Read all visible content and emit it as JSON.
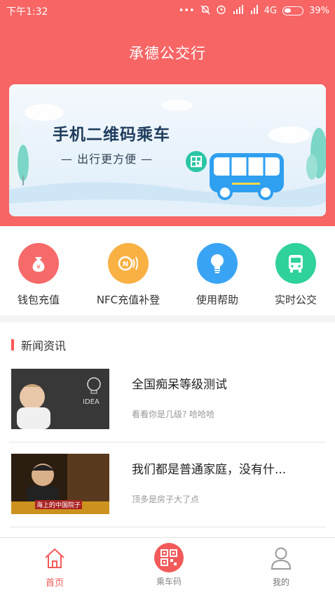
{
  "status": {
    "time": "下午1:32",
    "network": "4G",
    "battery": "39%"
  },
  "header": {
    "title": "承德公交行"
  },
  "banner": {
    "title": "手机二维码乘车",
    "subtitle": "— 出行更方便 —"
  },
  "actions": [
    {
      "label": "钱包充值",
      "icon": "money-bag-icon",
      "color": "#f76a6a"
    },
    {
      "label": "NFC充值补登",
      "icon": "nfc-icon",
      "color": "#f9b144"
    },
    {
      "label": "使用帮助",
      "icon": "lightbulb-icon",
      "color": "#3aa4f4"
    },
    {
      "label": "实时公交",
      "icon": "bus-icon",
      "color": "#2fd29a"
    }
  ],
  "news": {
    "heading": "新闻资讯",
    "items": [
      {
        "title": "全国痴呆等级测试",
        "subtitle": "看看你是几级? 哈哈哈",
        "thumb_text": "IDEA"
      },
      {
        "title": "我们都是普通家庭，没有什...",
        "subtitle": "顶多是房子大了点",
        "thumb_text": "海上的中国院子"
      }
    ]
  },
  "tabbar": {
    "tabs": [
      {
        "label": "首页",
        "icon": "home-icon",
        "active": true
      },
      {
        "label": "乘车码",
        "icon": "qr-code-icon",
        "active": false
      },
      {
        "label": "我的",
        "icon": "user-icon",
        "active": false
      }
    ],
    "active_color": "#f25a5a"
  }
}
